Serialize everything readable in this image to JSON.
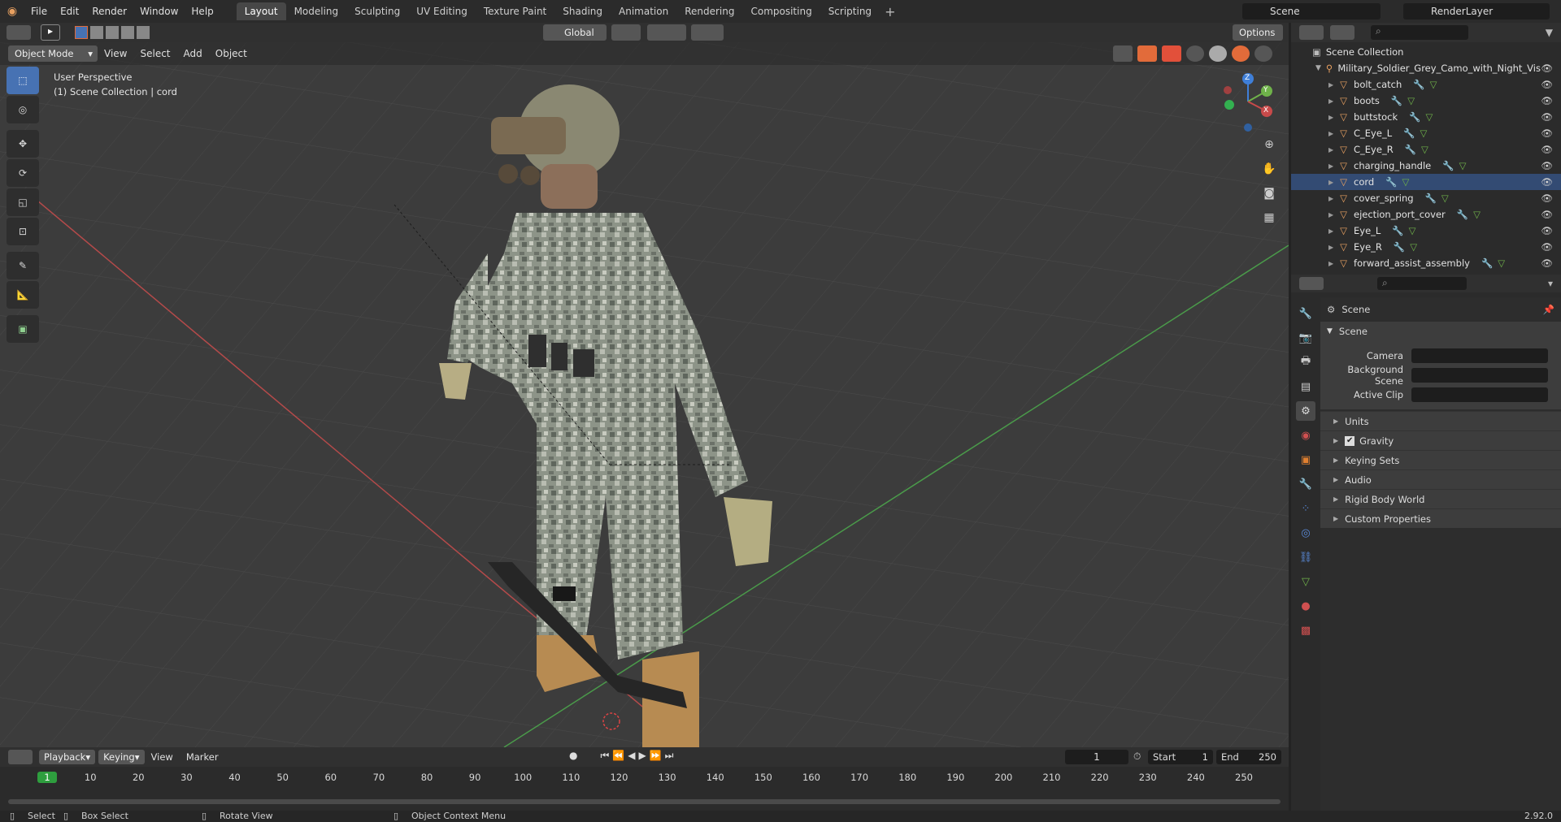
{
  "menus": [
    "File",
    "Edit",
    "Render",
    "Window",
    "Help"
  ],
  "workspaces": [
    "Layout",
    "Modeling",
    "Sculpting",
    "UV Editing",
    "Texture Paint",
    "Shading",
    "Animation",
    "Rendering",
    "Compositing",
    "Scripting"
  ],
  "active_workspace": "Layout",
  "scene_name": "Scene",
  "view_layer": "RenderLayer",
  "header": {
    "orientation": "Global",
    "options": "Options",
    "mode": "Object Mode",
    "view": "View",
    "select": "Select",
    "add": "Add",
    "object": "Object"
  },
  "viewport": {
    "perspective": "User Perspective",
    "collection_info": "(1) Scene Collection | cord",
    "gizmo": {
      "x": "X",
      "y": "Y",
      "z": "Z"
    }
  },
  "outliner": {
    "root": "Scene Collection",
    "object": "Military_Soldier_Grey_Camo_with_Night_Vis",
    "items": [
      "bolt_catch",
      "boots",
      "buttstock",
      "C_Eye_L",
      "C_Eye_R",
      "charging_handle",
      "cord",
      "cover_spring",
      "ejection_port_cover",
      "Eye_L",
      "Eye_R",
      "forward_assist_assembly"
    ]
  },
  "properties": {
    "header": "Scene",
    "section": "Scene",
    "fields": [
      "Camera",
      "Background Scene",
      "Active Clip"
    ],
    "subsections": [
      "Units",
      "Gravity",
      "Keying Sets",
      "Audio",
      "Rigid Body World",
      "Custom Properties"
    ]
  },
  "timeline": {
    "playback": "Playback",
    "keying": "Keying",
    "view": "View",
    "marker": "Marker",
    "current_frame": "1",
    "start_label": "Start",
    "start": "1",
    "end_label": "End",
    "end": "250",
    "ticks": [
      "1",
      "10",
      "20",
      "30",
      "40",
      "50",
      "60",
      "70",
      "80",
      "90",
      "100",
      "110",
      "120",
      "130",
      "140",
      "150",
      "160",
      "170",
      "180",
      "190",
      "200",
      "210",
      "220",
      "230",
      "240",
      "250"
    ]
  },
  "status": {
    "select": "Select",
    "box_select": "Box Select",
    "rotate_view": "Rotate View",
    "context_menu": "Object Context Menu",
    "version": "2.92.0"
  },
  "colors": {
    "accent": "#4772b3",
    "x_axis": "#c84a4a",
    "y_axis": "#6fb24a",
    "z_axis": "#3f7fd8",
    "frame_green": "#2e9e3e"
  }
}
